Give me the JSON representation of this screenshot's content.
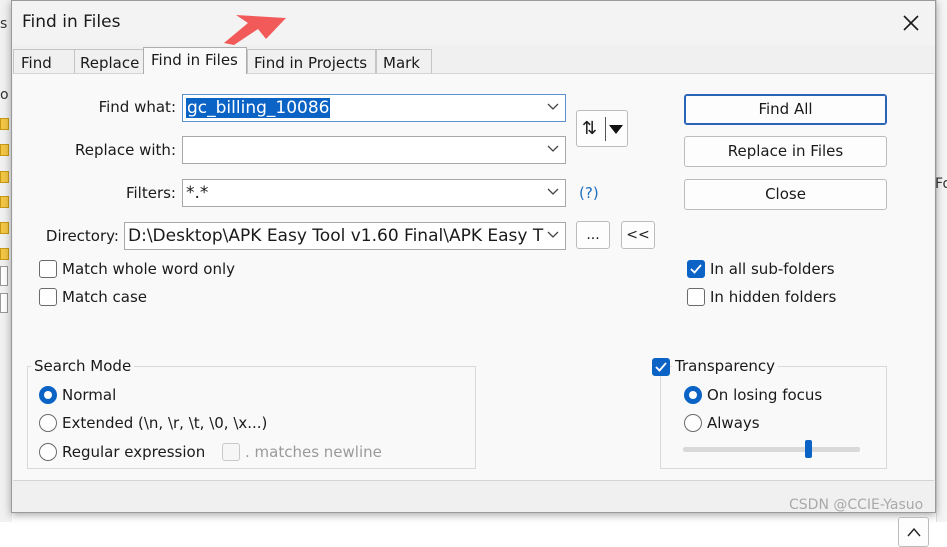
{
  "dialog": {
    "title": "Find in Files",
    "tabs": [
      {
        "label": "Find"
      },
      {
        "label": "Replace"
      },
      {
        "label": "Find in Files"
      },
      {
        "label": "Find in Projects"
      },
      {
        "label": "Mark"
      }
    ],
    "active_tab": "Find in Files"
  },
  "form": {
    "find_what_label": "Find what:",
    "find_what_value": "gc_billing_10086",
    "replace_with_label": "Replace with:",
    "replace_with_value": "",
    "filters_label": "Filters:",
    "filters_value": "*.*",
    "filters_help": "(?)",
    "directory_label": "Directory:",
    "directory_value": "D:\\Desktop\\APK Easy Tool v1.60 Final\\APK Easy T",
    "browse_label": "...",
    "follow_label": "<<"
  },
  "buttons": {
    "find_all": "Find All",
    "replace_in_files": "Replace in Files",
    "close": "Close",
    "swap_glyph": "⇅",
    "collapse_glyph": "^"
  },
  "options": {
    "match_whole_word": {
      "label": "Match whole word only",
      "checked": false
    },
    "match_case": {
      "label": "Match case",
      "checked": false
    },
    "in_all_subfolders": {
      "label": "In all sub-folders",
      "checked": true
    },
    "in_hidden_folders": {
      "label": "In hidden folders",
      "checked": false
    }
  },
  "search_mode": {
    "title": "Search Mode",
    "normal": "Normal",
    "extended": "Extended (\\n, \\r, \\t, \\0, \\x...)",
    "regex": "Regular expression",
    "matches_newline": ". matches newline",
    "selected": "Normal"
  },
  "transparency": {
    "label": "Transparency",
    "enabled": true,
    "on_losing_focus": "On losing focus",
    "always": "Always",
    "selected": "On losing focus"
  },
  "background": {
    "left_fragment_1": "s",
    "left_fragment_2": "o",
    "right_fragment": "Fo"
  },
  "watermark": "CSDN @CCIE-Yasuo",
  "colors": {
    "accent": "#0b63c5",
    "arrow": "#f25a5a"
  }
}
